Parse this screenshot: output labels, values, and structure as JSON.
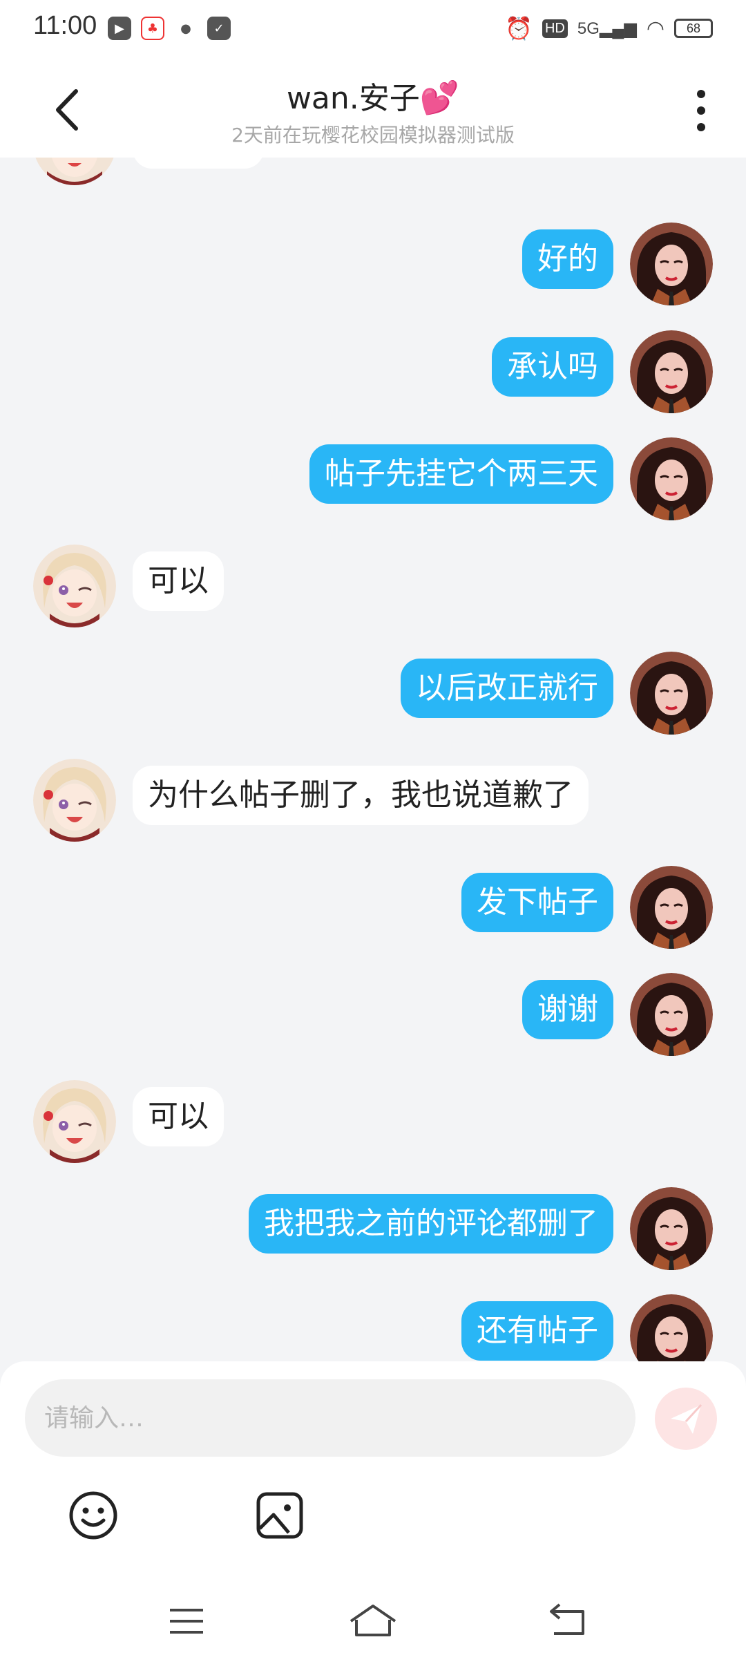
{
  "status_bar": {
    "time": "11:00",
    "battery": "68",
    "network": "5G",
    "hd": "HD"
  },
  "header": {
    "title": "wan.安子",
    "subtitle": "2天前在玩樱花校园模拟器测试版"
  },
  "messages": [
    {
      "side": "me",
      "text": "好的"
    },
    {
      "side": "me",
      "text": "承认吗"
    },
    {
      "side": "me",
      "text": "帖子先挂它个两三天"
    },
    {
      "side": "other",
      "text": "可以"
    },
    {
      "side": "me",
      "text": "以后改正就行"
    },
    {
      "side": "other",
      "text": "为什么帖子删了，我也说道歉了"
    },
    {
      "side": "me",
      "text": "发下帖子"
    },
    {
      "side": "me",
      "text": "谢谢"
    },
    {
      "side": "other",
      "text": "可以"
    },
    {
      "side": "me",
      "text": "我把我之前的评论都删了"
    },
    {
      "side": "me",
      "text": "还有帖子"
    }
  ],
  "composer": {
    "placeholder": "请输入…",
    "value": ""
  },
  "colors": {
    "accent": "#29b6f6",
    "heart": "#f0509b",
    "send_disabled": "#fde4e4"
  },
  "icons": {
    "back": "chevron-left-icon",
    "more": "more-vertical-icon",
    "send": "send-icon",
    "emoji": "smiley-icon",
    "image": "image-icon",
    "menu": "menu-icon",
    "home": "home-icon",
    "return": "back-nav-icon"
  }
}
